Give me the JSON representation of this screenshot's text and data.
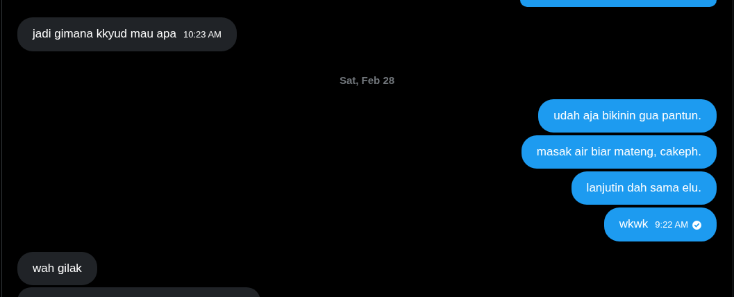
{
  "messages": [
    {
      "kind": "sent"
    },
    {
      "kind": "received",
      "text": "jadi gimana kkyud mau apa",
      "time": "10:23 AM"
    },
    {
      "kind": "date",
      "text": "Sat, Feb 28"
    },
    {
      "kind": "sent",
      "text": "udah aja bikinin gua pantun."
    },
    {
      "kind": "sent",
      "text": "masak air biar mateng, cakeph."
    },
    {
      "kind": "sent",
      "text": "lanjutin dah sama elu."
    },
    {
      "kind": "sent",
      "text": "wkwk",
      "time": "9:22 AM",
      "seen": true
    },
    {
      "kind": "received",
      "text": "wah gilak"
    },
    {
      "kind": "received"
    }
  ]
}
